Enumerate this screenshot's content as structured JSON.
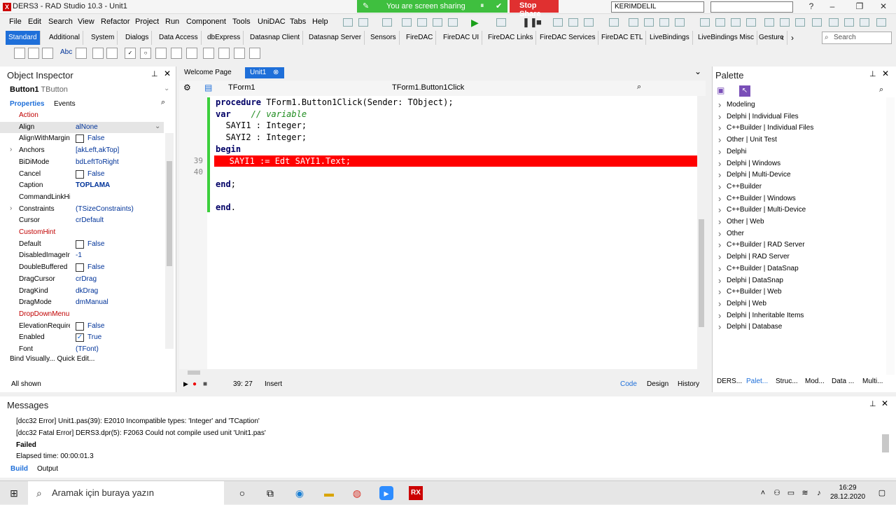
{
  "titlebar": {
    "title": "DERS3 - RAD Studio 10.3 - Unit1",
    "share_text": "You are screen sharing",
    "stop_share": "Stop Share",
    "user": "KERIMDELIL"
  },
  "menu": [
    "File",
    "Edit",
    "Search",
    "View",
    "Refactor",
    "Project",
    "Run",
    "Component",
    "Tools",
    "UniDAC",
    "Tabs",
    "Help"
  ],
  "palette_tabs": [
    "Standard",
    "Additional",
    "System",
    "Dialogs",
    "Data Access",
    "dbExpress",
    "Datasnap Client",
    "Datasnap Server",
    "Sensors",
    "FireDAC",
    "FireDAC UI",
    "FireDAC Links",
    "FireDAC Services",
    "FireDAC ETL",
    "LiveBindings",
    "LiveBindings Misc",
    "Gesture"
  ],
  "palette_search_placeholder": "Search",
  "object_inspector": {
    "title": "Object Inspector",
    "selected_name": "Button1",
    "selected_type": "TButton",
    "tabs": [
      "Properties",
      "Events"
    ],
    "properties": [
      {
        "name": "Action",
        "value": "",
        "red": true
      },
      {
        "name": "Align",
        "value": "alNone",
        "highlight": true
      },
      {
        "name": "AlignWithMargins",
        "value": "False",
        "check": true
      },
      {
        "name": "Anchors",
        "value": "[akLeft,akTop]"
      },
      {
        "name": "BiDiMode",
        "value": "bdLeftToRight"
      },
      {
        "name": "Cancel",
        "value": "False",
        "check": true
      },
      {
        "name": "Caption",
        "value": "TOPLAMA",
        "bold": true
      },
      {
        "name": "CommandLinkHint",
        "value": ""
      },
      {
        "name": "Constraints",
        "value": "(TSizeConstraints)"
      },
      {
        "name": "Cursor",
        "value": "crDefault"
      },
      {
        "name": "CustomHint",
        "value": "",
        "red": true
      },
      {
        "name": "Default",
        "value": "False",
        "check": true
      },
      {
        "name": "DisabledImageIndex",
        "value": "-1"
      },
      {
        "name": "DoubleBuffered",
        "value": "False",
        "check": true
      },
      {
        "name": "DragCursor",
        "value": "crDrag"
      },
      {
        "name": "DragKind",
        "value": "dkDrag"
      },
      {
        "name": "DragMode",
        "value": "dmManual"
      },
      {
        "name": "DropDownMenu",
        "value": "",
        "red": true
      },
      {
        "name": "ElevationRequired",
        "value": "False",
        "check": true
      },
      {
        "name": "Enabled",
        "value": "True",
        "check": true,
        "checked": true
      },
      {
        "name": "Font",
        "value": "(TFont)"
      }
    ],
    "footer_links": "Bind Visually...  Quick Edit...",
    "footer_status": "All shown"
  },
  "editor": {
    "tabs": [
      "Welcome Page",
      "Unit1"
    ],
    "class_combo": "TForm1",
    "method_combo": "TForm1.Button1Click",
    "lines": [
      {
        "num": "",
        "text": "procedure TForm1.Button1Click(Sender: TObject);"
      },
      {
        "num": "",
        "text": "var    // variable"
      },
      {
        "num": "",
        "text": "  SAYI1 : Integer;"
      },
      {
        "num": "",
        "text": "  SAYI2 : Integer;"
      },
      {
        "num": "",
        "text": "begin"
      },
      {
        "num": "39",
        "text": "   SAYI1 := Edt SAYI1.Text;"
      },
      {
        "num": "40",
        "text": ""
      },
      {
        "num": "",
        "text": "end;"
      },
      {
        "num": "",
        "text": ""
      },
      {
        "num": "",
        "text": "end."
      }
    ],
    "position": "39: 27",
    "mode": "Insert",
    "view_tabs": [
      "Code",
      "Design",
      "History"
    ]
  },
  "palette": {
    "title": "Palette",
    "items": [
      "Modeling",
      "Delphi | Individual Files",
      "C++Builder | Individual Files",
      "Other | Unit Test",
      "Delphi",
      "Delphi | Windows",
      "Delphi | Multi-Device",
      "C++Builder",
      "C++Builder | Windows",
      "C++Builder | Multi-Device",
      "Other | Web",
      "Other",
      "C++Builder | RAD Server",
      "Delphi | RAD Server",
      "C++Builder | DataSnap",
      "Delphi | DataSnap",
      "C++Builder | Web",
      "Delphi | Web",
      "Delphi | Inheritable Items",
      "Delphi | Database"
    ],
    "bottom_tabs": [
      "DERS...",
      "Palet...",
      "Struc...",
      "Mod...",
      "Data ...",
      "Multi..."
    ]
  },
  "messages": {
    "title": "Messages",
    "lines": [
      "[dcc32 Error] Unit1.pas(39): E2010 Incompatible types: 'Integer' and 'TCaption'",
      "[dcc32 Fatal Error] DERS3.dpr(5): F2063 Could not compile used unit 'Unit1.pas'",
      "Failed",
      "Elapsed time: 00:00:01.3"
    ],
    "tabs": [
      "Build",
      "Output"
    ]
  },
  "taskbar": {
    "search_placeholder": "Aramak için buraya yazın",
    "time": "16:29",
    "date": "28.12.2020"
  },
  "colors": {
    "accent": "#1e6fd9",
    "error_line": "#ff0000",
    "share_green": "#3fbf3f",
    "stop_red": "#e03030"
  }
}
